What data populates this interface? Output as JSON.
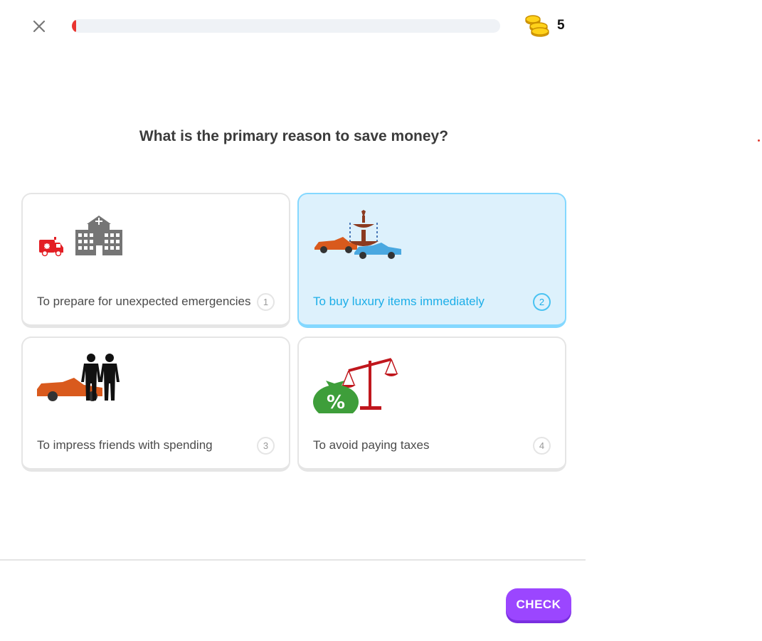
{
  "header": {
    "close_icon": "close-icon",
    "progress": 0.01,
    "progress_color": "#e9342f",
    "coins_icon": "coin-stack-icon",
    "coins_count": "5"
  },
  "question": {
    "text": "What is the primary reason to save money?"
  },
  "options": [
    {
      "label": "To prepare for unexpected emergencies",
      "number": "1",
      "icon": "ambulance-hospital-icon",
      "selected": false
    },
    {
      "label": "To buy luxury items immediately",
      "number": "2",
      "icon": "luxury-cars-fountain-icon",
      "selected": true
    },
    {
      "label": "To impress friends with spending",
      "number": "3",
      "icon": "car-friends-icon",
      "selected": false
    },
    {
      "label": "To avoid paying taxes",
      "number": "4",
      "icon": "money-bag-scales-icon",
      "selected": false
    }
  ],
  "footer": {
    "check_label": "CHECK"
  },
  "colors": {
    "accent": "#9b46ff",
    "selected_bg": "#ddf1fc",
    "selected_border": "#84d8ff",
    "selected_text": "#1caee8"
  }
}
